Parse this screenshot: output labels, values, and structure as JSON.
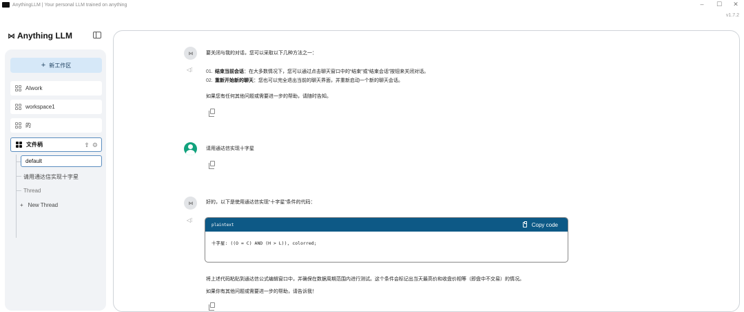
{
  "window": {
    "title": "AnythingLLM | Your personal LLM trained on anything",
    "version": "v1.7.2",
    "controls": [
      "–",
      "☐",
      "✕"
    ]
  },
  "brand": {
    "logo": "⋈",
    "name": "Anything LLM"
  },
  "sidebar": {
    "new_workspace_label": "新工作区",
    "workspaces": [
      {
        "label": "AIwork"
      },
      {
        "label": "workspace1"
      },
      {
        "label": "的"
      },
      {
        "label": "文件柄",
        "active": true
      }
    ],
    "threads": [
      {
        "label": "default",
        "active": true
      },
      {
        "label": "请用通达信实现十字星"
      },
      {
        "label": "Thread"
      }
    ],
    "new_thread_label": "New Thread"
  },
  "chat": {
    "messages": [
      {
        "role": "assistant",
        "intro": "要关闭与我的对话，您可以采取以下几种方法之一：",
        "list": [
          {
            "num": "01.",
            "bold": "结束当前会话",
            "text": "：在大多数情况下，您可以通过点击聊天窗口中的“结束”或“结束会话”按钮来关闭对话。"
          },
          {
            "num": "02.",
            "bold": "重新开始新的聊天",
            "text": "：您也可以完全退出当前的聊天界面，并重新启动一个新的聊天会话。"
          }
        ],
        "outro": "如果您有任何其他问题或需要进一步的帮助，请随时告知。"
      },
      {
        "role": "user",
        "text": "请用通达信实现十字星"
      },
      {
        "role": "assistant",
        "intro": "好的，以下是使用通达信实现“十字星”条件的代码：",
        "code": {
          "lang": "plaintext",
          "copy_label": "Copy code",
          "content": "十字星: ((O = C) AND (H > L)), colorred;"
        },
        "after": "将上述代码粘贴到通达信公式编辑窗口中，并确保在数据周期范围内进行测试。这个条件会标记出当天最高价和收盘价相等（即盘中不交易）的情况。",
        "outro": "如果你有其他问题或需要进一步的帮助，请告诉我！"
      }
    ]
  }
}
